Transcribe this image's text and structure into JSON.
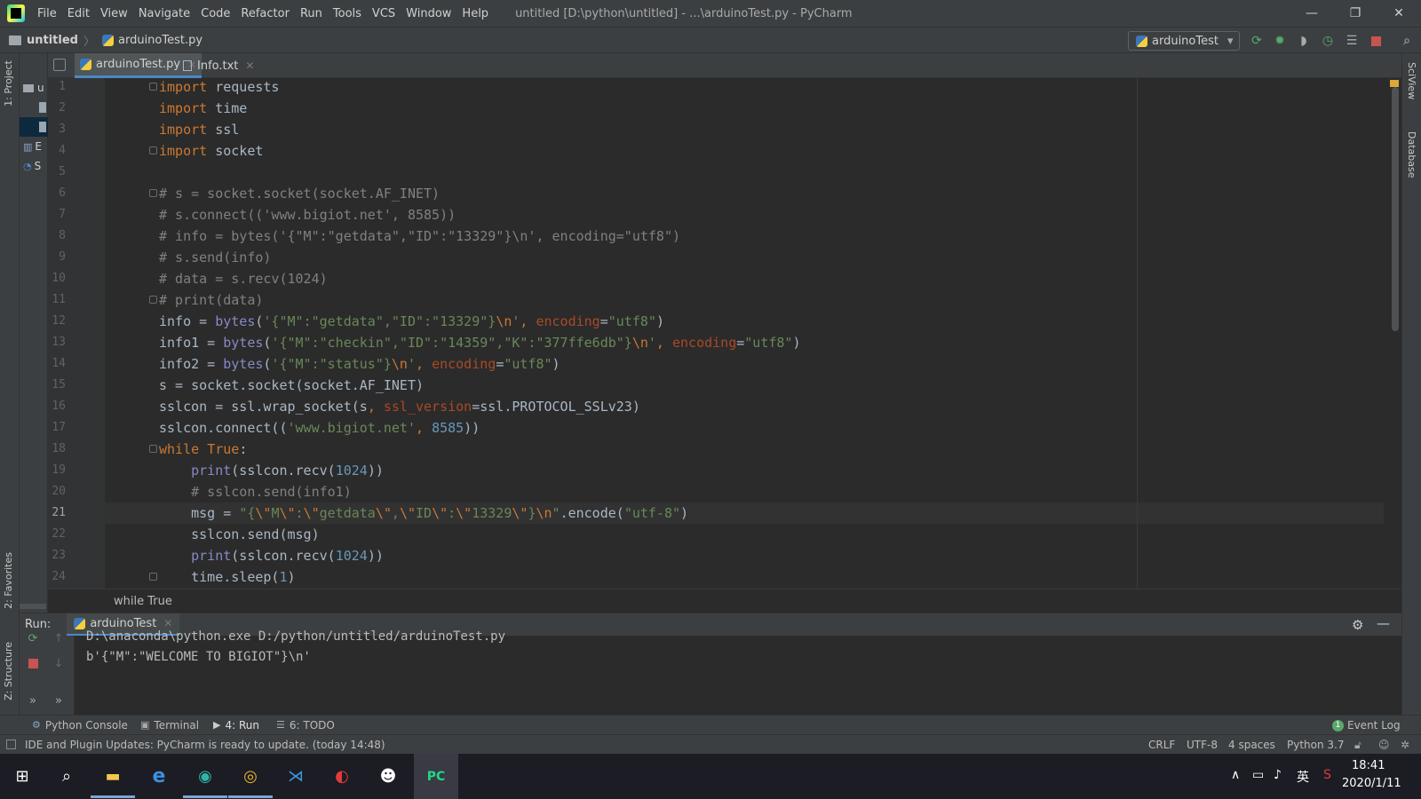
{
  "menu": [
    "File",
    "Edit",
    "View",
    "Navigate",
    "Code",
    "Refactor",
    "Run",
    "Tools",
    "VCS",
    "Window",
    "Help"
  ],
  "window_title": "untitled [D:\\python\\untitled] - ...\\arduinoTest.py - PyCharm",
  "window_controls": {
    "minimize": "—",
    "restore": "❐",
    "close": "✕"
  },
  "nav": {
    "project": "untitled",
    "file": "arduinoTest.py"
  },
  "run_config": {
    "name": "arduinoTest",
    "arrow": "▾"
  },
  "left_strip": {
    "project": "1: Project",
    "favorites": "2: Favorites",
    "structure": "Z: Structure"
  },
  "right_strip": {
    "sciview": "SciView",
    "database": "Database"
  },
  "project_rows": [
    "u",
    "E",
    "S"
  ],
  "tabs": [
    {
      "label": "arduinoTest.py",
      "active": true
    },
    {
      "label": "Info.txt",
      "active": false
    }
  ],
  "line_numbers": [
    "1",
    "2",
    "3",
    "4",
    "5",
    "6",
    "7",
    "8",
    "9",
    "10",
    "11",
    "12",
    "13",
    "14",
    "15",
    "16",
    "17",
    "18",
    "19",
    "20",
    "21",
    "22",
    "23",
    "24"
  ],
  "current_line": 21,
  "code_lines": [
    "import requests",
    "import time",
    "import ssl",
    "import socket",
    "",
    "# s = socket.socket(socket.AF_INET)",
    "# s.connect(('www.bigiot.net', 8585))",
    "# info = bytes('{\"M\":\"getdata\",\"ID\":\"13329\"}\\n', encoding=\"utf8\")",
    "# s.send(info)",
    "# data = s.recv(1024)",
    "# print(data)",
    "info = bytes('{\"M\":\"getdata\",\"ID\":\"13329\"}\\n', encoding=\"utf8\")",
    "info1 = bytes('{\"M\":\"checkin\",\"ID\":\"14359\",\"K\":\"377ffe6db\"}\\n', encoding=\"utf8\")",
    "info2 = bytes('{\"M\":\"status\"}\\n', encoding=\"utf8\")",
    "s = socket.socket(socket.AF_INET)",
    "sslcon = ssl.wrap_socket(s, ssl_version=ssl.PROTOCOL_SSLv23)",
    "sslcon.connect(('www.bigiot.net', 8585))",
    "while True:",
    "    print(sslcon.recv(1024))",
    "    # sslcon.send(info1)",
    "    msg = \"{\\\"M\\\":\\\"getdata\\\",\\\"ID\\\":\\\"13329\\\"}\\n\".encode(\"utf-8\")",
    "    sslcon.send(msg)",
    "    print(sslcon.recv(1024))",
    "    time.sleep(1)"
  ],
  "editor_breadcrumb": "while True",
  "run_panel": {
    "label": "Run:",
    "tab": "arduinoTest",
    "output": [
      "D:\\anaconda\\python.exe D:/python/untitled/arduinoTest.py",
      "b'{\"M\":\"WELCOME TO BIGIOT\"}\\n'"
    ]
  },
  "tool_tabs": [
    {
      "icon": "python-console-icon",
      "label": "Python Console"
    },
    {
      "icon": "terminal-icon",
      "label": "Terminal"
    },
    {
      "icon": "run-icon",
      "label": "4: Run"
    },
    {
      "icon": "todo-icon",
      "label": "6: TODO"
    }
  ],
  "event_log": {
    "badge": "1",
    "label": "Event Log"
  },
  "status": {
    "message": "IDE and Plugin Updates: PyCharm is ready to update. (today 14:48)",
    "line_sep": "CRLF",
    "encoding": "UTF-8",
    "indent": "4 spaces",
    "interpreter": "Python 3.7"
  },
  "taskbar": {
    "ime": "英",
    "time": "18:41",
    "date": "2020/1/11"
  },
  "colors": {
    "keyword": "#cc7832",
    "comment": "#808080",
    "string": "#6a8759",
    "number": "#6897bb",
    "builtin": "#8888c6",
    "kwarg": "#aa4926",
    "accent": "#4a88c7"
  }
}
